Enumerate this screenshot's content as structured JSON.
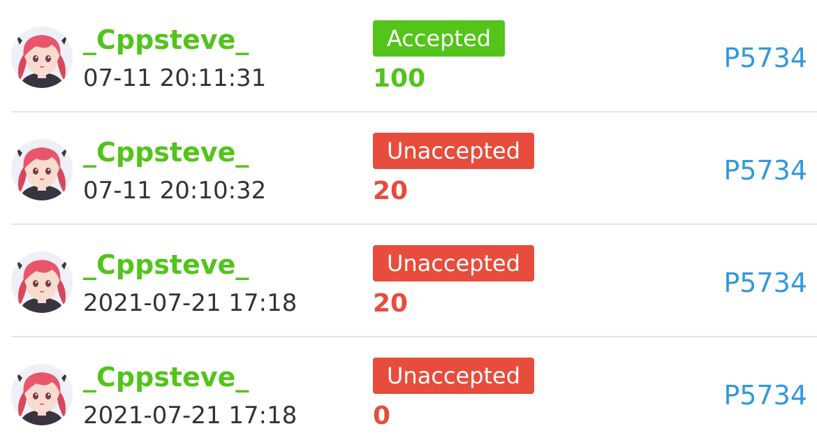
{
  "colors": {
    "username": "#52c41a",
    "accepted": "#52c41a",
    "unaccepted": "#e74c3c",
    "link": "#3498db",
    "text": "#333333",
    "divider": "#e5e5e5"
  },
  "records": [
    {
      "avatar_icon": "anime-girl-avatar-icon",
      "username": "_Cppsteve_",
      "time": "07-11 20:11:31",
      "status": "Accepted",
      "status_color": "#52c41a",
      "score": "100",
      "problem": "P5734"
    },
    {
      "avatar_icon": "anime-girl-avatar-icon",
      "username": "_Cppsteve_",
      "time": "07-11 20:10:32",
      "status": "Unaccepted",
      "status_color": "#e74c3c",
      "score": "20",
      "problem": "P5734"
    },
    {
      "avatar_icon": "anime-girl-avatar-icon",
      "username": "_Cppsteve_",
      "time": "2021-07-21 17:18",
      "status": "Unaccepted",
      "status_color": "#e74c3c",
      "score": "20",
      "problem": "P5734"
    },
    {
      "avatar_icon": "anime-girl-avatar-icon",
      "username": "_Cppsteve_",
      "time": "2021-07-21 17:18",
      "status": "Unaccepted",
      "status_color": "#e74c3c",
      "score": "0",
      "problem": "P5734"
    }
  ]
}
